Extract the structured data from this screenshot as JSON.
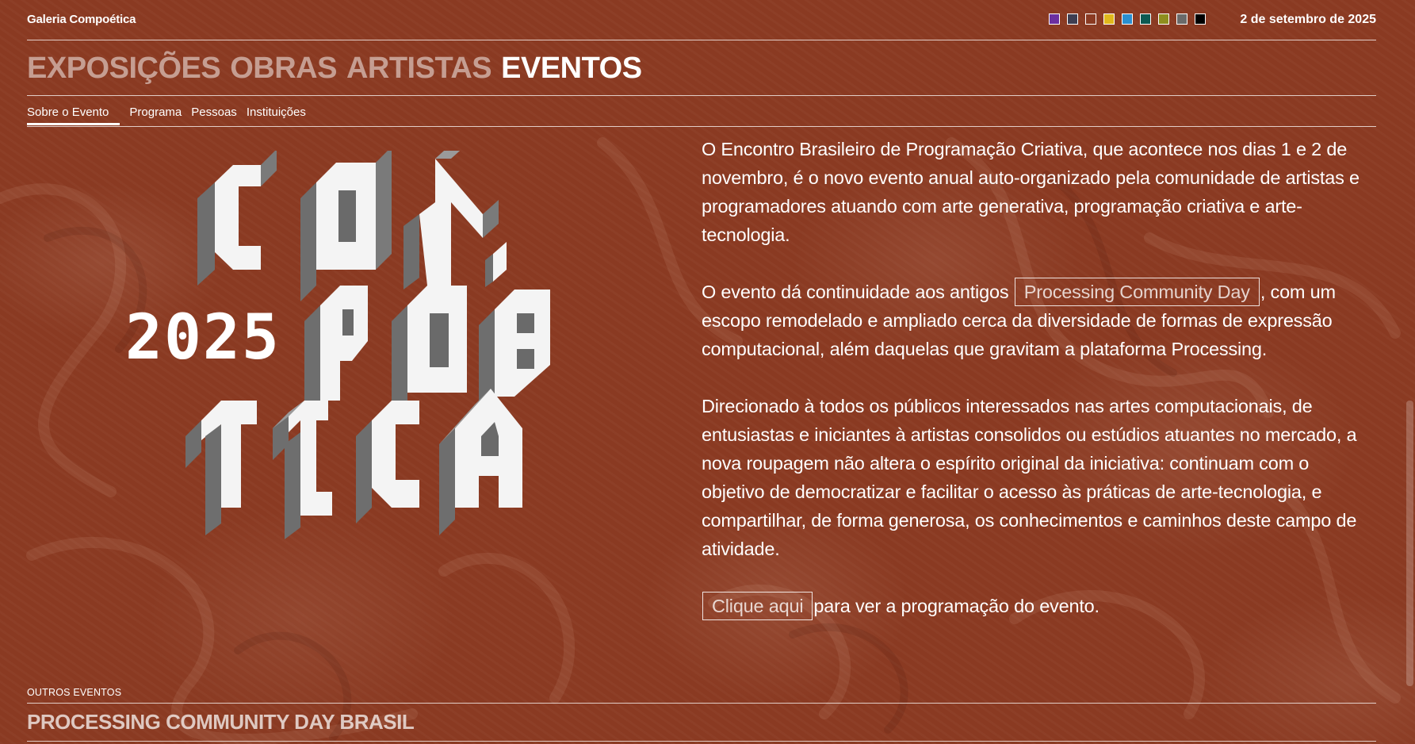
{
  "site": {
    "name": "Galeria Compoética",
    "date": "2 de setembro de 2025"
  },
  "theme_swatches": [
    {
      "name": "purple",
      "color": "#6b2fa0"
    },
    {
      "name": "slate",
      "color": "#3e3e52"
    },
    {
      "name": "rust",
      "color": "#8a3a22"
    },
    {
      "name": "yellow",
      "color": "#e0b81c"
    },
    {
      "name": "blue",
      "color": "#2a8fd0"
    },
    {
      "name": "teal",
      "color": "#0d5a52"
    },
    {
      "name": "olive",
      "color": "#8e8e1e"
    },
    {
      "name": "gray",
      "color": "#6a6a6a"
    },
    {
      "name": "black",
      "color": "#000000"
    }
  ],
  "section_nav": {
    "exposicoes": "EXPOSIÇÕES",
    "obras": "OBRAS",
    "artistas": "ARTISTAS",
    "eventos": "EVENTOS"
  },
  "sub_nav": {
    "sobre": "Sobre o Evento",
    "programa": "Programa",
    "pessoas": "Pessoas",
    "instituicoes": "Instituições"
  },
  "logo": {
    "year": "2025",
    "letters": [
      "C",
      "O",
      "M",
      "P",
      "O",
      "É",
      "T",
      "I",
      "C",
      "A"
    ]
  },
  "content": {
    "p1": "O Encontro Brasileiro de Programação Criativa, que acontece nos dias 1 e 2 de novembro, é o novo evento anual auto-organizado pela comunidade de artistas e programadores atuando com arte generativa, programação criativa e arte-tecnologia.",
    "p2_before": "O evento dá continuidade aos antigos",
    "p2_link": "Processing Community Day",
    "p2_after": ", com um escopo remodelado e ampliado cerca da diversidade de formas de expressão computacional, além daquelas que gravitam a plataforma Processing.",
    "p3": "Direcionado à todos os públicos interessados nas artes computacionais, de entusiastas e iniciantes à artistas consolidos ou estúdios atuantes no mercado, a nova roupagem não altera o espírito original da iniciativa: continuam com o objetivo de democratizar e facilitar o acesso às práticas de arte-tecnologia, e compartilhar, de forma generosa, os conhecimentos e caminhos deste campo de atividade.",
    "p4_link": "Clique aqui",
    "p4_after": "para ver a programação do evento."
  },
  "footer": {
    "other_label": "OUTROS EVENTOS",
    "other_title": "PROCESSING COMMUNITY DAY BRASIL"
  }
}
